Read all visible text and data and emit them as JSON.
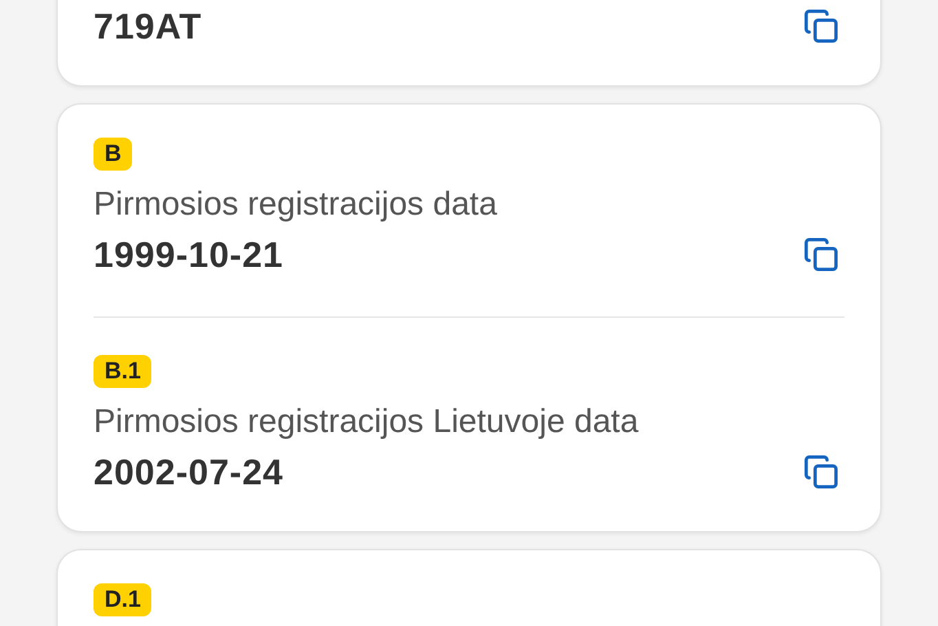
{
  "cards": [
    {
      "fields": [
        {
          "value": "719AT"
        }
      ]
    },
    {
      "fields": [
        {
          "badge": "B",
          "label": "Pirmosios registracijos data",
          "value": "1999-10-21"
        },
        {
          "badge": "B.1",
          "label": "Pirmosios registracijos Lietuvoje data",
          "value": "2002-07-24"
        }
      ]
    },
    {
      "fields": [
        {
          "badge": "D.1"
        }
      ]
    }
  ]
}
